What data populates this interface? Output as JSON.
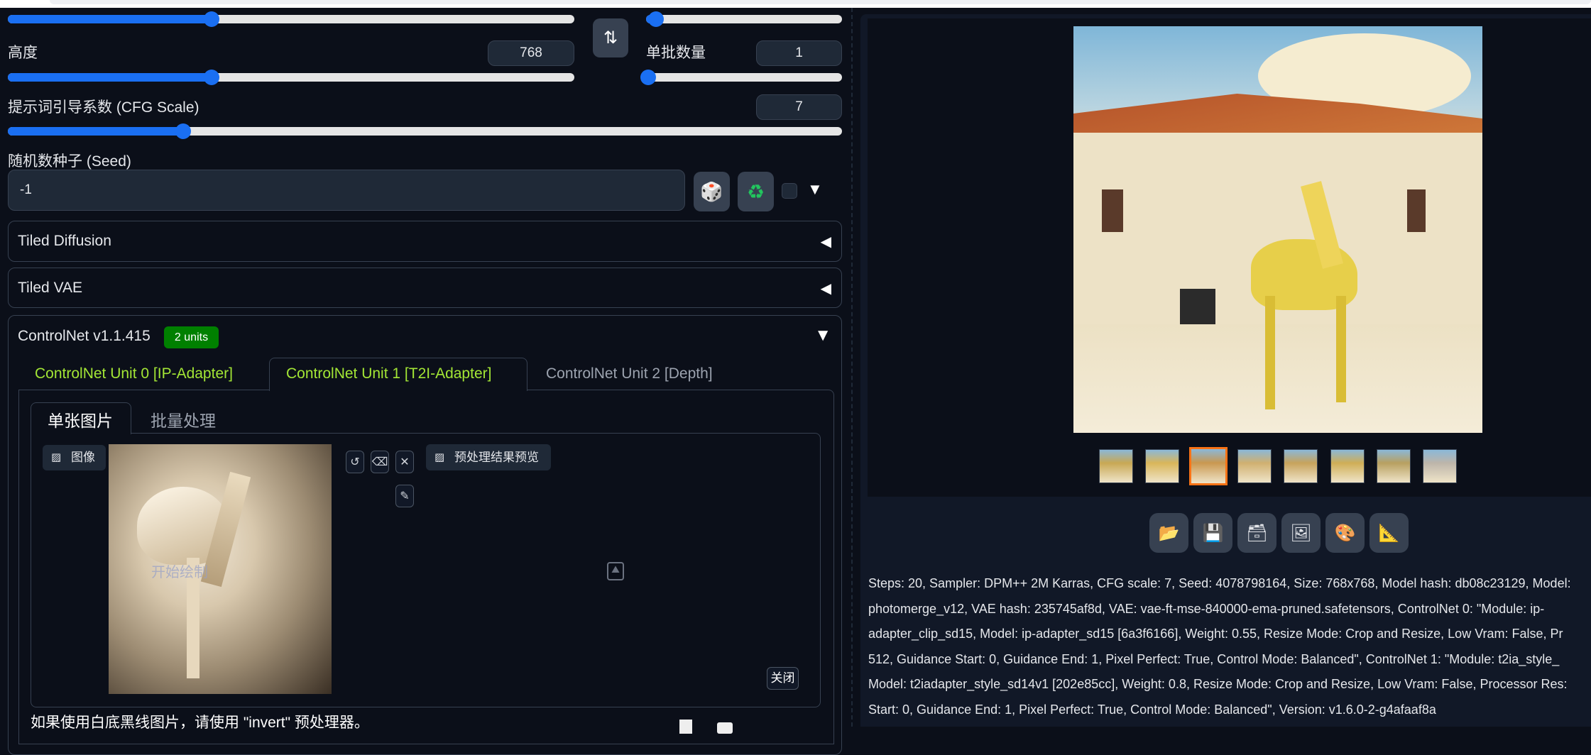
{
  "left": {
    "height_label": "高度",
    "height_value": "768",
    "width_slider_fraction": 0.36,
    "height_slider_fraction": 0.36,
    "batch_count_slider_fraction": 0.05,
    "batch_size_label": "单批数量",
    "batch_size_value": "1",
    "batch_size_slider_fraction": 0.01,
    "cfg_label": "提示词引导系数 (CFG Scale)",
    "cfg_value": "7",
    "cfg_slider_fraction": 0.21,
    "seed_label": "随机数种子 (Seed)",
    "seed_value": "-1",
    "swap_icon": "⇅",
    "dice_icon": "🎲",
    "recycle_icon": "♻",
    "extra_arrow": "▼",
    "accordions": {
      "tiled_diffusion": "Tiled Diffusion",
      "tiled_vae": "Tiled VAE",
      "collapsed_arrow": "◀"
    },
    "controlnet": {
      "title": "ControlNet v1.1.415",
      "badge": "2 units",
      "expand_arrow": "▼",
      "tabs": [
        "ControlNet Unit 0 [IP-Adapter]",
        "ControlNet Unit 1 [T2I-Adapter]",
        "ControlNet Unit 2 [Depth]"
      ],
      "subtabs": [
        "单张图片",
        "批量处理"
      ],
      "image_label": "图像",
      "image_overlay_text": "开始绘制",
      "preview_label": "预处理结果预览",
      "close_label": "关闭",
      "hint": "如果使用白底黑线图片，请使用 \"invert\" 预处理器。",
      "accent": "#a3e635",
      "badge_color": "#008000"
    }
  },
  "right": {
    "thumbnail_count": 8,
    "selected_thumbnail": 3,
    "toolbar": [
      "folder-icon",
      "save-icon",
      "zip-icon",
      "image-icon",
      "palette-icon",
      "ruler-icon"
    ],
    "info_lines": [
      "Steps: 20, Sampler: DPM++ 2M Karras, CFG scale: 7, Seed: 4078798164, Size: 768x768, Model hash: db08c23129, Model:",
      "photomerge_v12, VAE hash: 235745af8d, VAE: vae-ft-mse-840000-ema-pruned.safetensors, ControlNet 0: \"Module: ip-",
      "adapter_clip_sd15, Model: ip-adapter_sd15 [6a3f6166], Weight: 0.55, Resize Mode: Crop and Resize, Low Vram: False, Pr",
      "512, Guidance Start: 0, Guidance End: 1, Pixel Perfect: True, Control Mode: Balanced\", ControlNet 1: \"Module: t2ia_style_",
      "Model: t2iadapter_style_sd14v1 [202e85cc], Weight: 0.8, Resize Mode: Crop and Resize, Low Vram: False, Processor Res:",
      "Start: 0, Guidance End: 1, Pixel Perfect: True, Control Mode: Balanced\", Version: v1.6.0-2-g4afaaf8a"
    ]
  }
}
